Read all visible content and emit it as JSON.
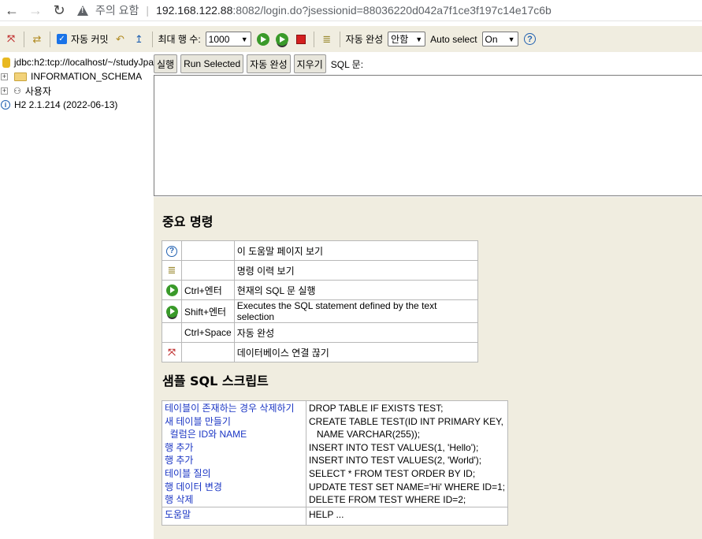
{
  "browser": {
    "back_icon": "←",
    "forward_icon": "→",
    "reload_icon": "↻",
    "security_label": "주의 요함",
    "url_host": "192.168.122.88",
    "url_rest": ":8082/login.do?jsessionid=88036220d042a7f1ce3f197c14e17c6b"
  },
  "toolbar": {
    "autocommit_label": "자동 커밋",
    "maxrows_label": "최대 행 수:",
    "maxrows_value": "1000",
    "autocomplete_label": "자동 완성",
    "autocomplete_value": "안함",
    "autoselect_label": "Auto select",
    "autoselect_value": "On",
    "help_icon_char": "?"
  },
  "tree": {
    "connection": "jdbc:h2:tcp://localhost/~/studyJpa",
    "items": [
      {
        "label": "INFORMATION_SCHEMA"
      },
      {
        "label": "사용자"
      }
    ],
    "version": "H2 2.1.214 (2022-06-13)"
  },
  "sql": {
    "run_label": "실행",
    "run_selected_label": "Run Selected",
    "autocomplete_label": "자동 완성",
    "clear_label": "지우기",
    "sql_label": "SQL 문:"
  },
  "important": {
    "heading": "중요 명령",
    "rows": [
      {
        "icon": "help-icon",
        "key": "",
        "desc": "이 도움말 페이지 보기"
      },
      {
        "icon": "history-icon",
        "key": "",
        "desc": "명령 이력 보기"
      },
      {
        "icon": "run-icon",
        "key": "Ctrl+엔터",
        "desc": "현재의 SQL 문 실행"
      },
      {
        "icon": "run-selected-icon",
        "key": "Shift+엔터",
        "desc": "Executes the SQL statement defined by the text selection"
      },
      {
        "icon": "",
        "key": "Ctrl+Space",
        "desc": "자동 완성"
      },
      {
        "icon": "disconnect-icon",
        "key": "",
        "desc": "데이터베이스 연결 끊기"
      }
    ]
  },
  "sample": {
    "heading": "샘플 SQL 스크립트",
    "links": [
      "테이블이 존재하는 경우 삭제하기",
      "새 테이블 만들기",
      "  컬럼은 ID와 NAME",
      "행 추가",
      "행 추가",
      "테이블 질의",
      "행 데이터 변경",
      "행 삭제"
    ],
    "code": [
      "DROP TABLE IF EXISTS TEST;",
      "CREATE TABLE TEST(ID INT PRIMARY KEY,",
      "   NAME VARCHAR(255));",
      "INSERT INTO TEST VALUES(1, 'Hello');",
      "INSERT INTO TEST VALUES(2, 'World');",
      "SELECT * FROM TEST ORDER BY ID;",
      "UPDATE TEST SET NAME='Hi' WHERE ID=1;",
      "DELETE FROM TEST WHERE ID=2;"
    ],
    "help_link": "도움말",
    "help_code": "HELP ..."
  }
}
